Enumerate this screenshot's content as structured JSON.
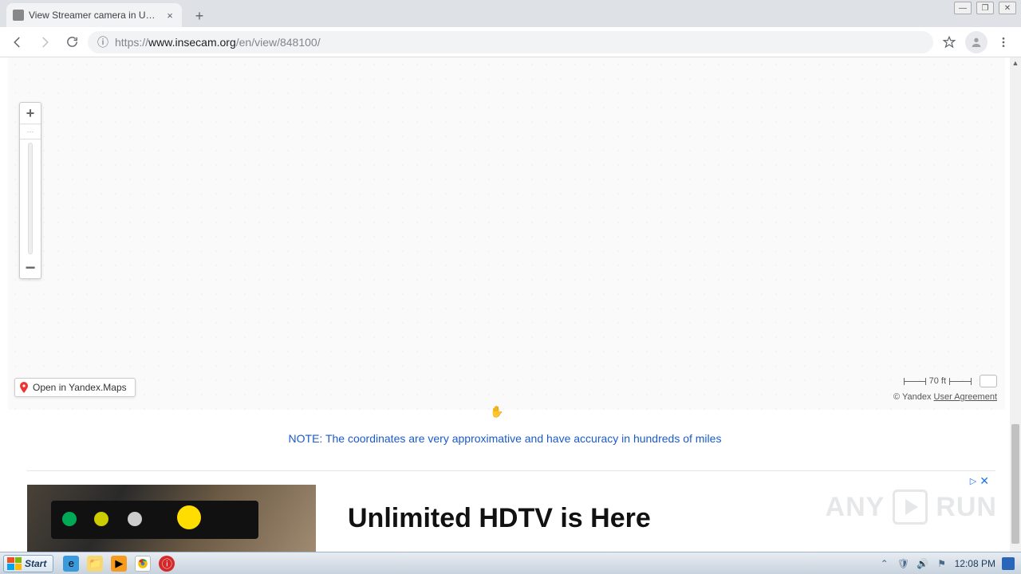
{
  "window": {
    "minimize": "—",
    "maximize": "❐",
    "close": "✕"
  },
  "tab": {
    "title": "View Streamer camera in United Sta",
    "close": "×",
    "new": "+"
  },
  "omnibox": {
    "scheme": "https://",
    "host": "www.insecam.org",
    "path": "/en/view/848100/",
    "info_icon": "ⓘ"
  },
  "map": {
    "zoom_in": "+",
    "zoom_out": "−",
    "open_link": "Open in Yandex.Maps",
    "scale_label": "70 ft",
    "credit_prefix": "© Yandex ",
    "credit_link": "User Agreement"
  },
  "note": "NOTE: The coordinates are very approximative and have accuracy in hundreds of miles",
  "ad": {
    "headline": "Unlimited HDTV is Here",
    "badge": "▷",
    "close": "✕"
  },
  "watermark": {
    "left": "ANY",
    "right": "RUN"
  },
  "taskbar": {
    "start": "Start",
    "clock": "12:08 PM"
  }
}
